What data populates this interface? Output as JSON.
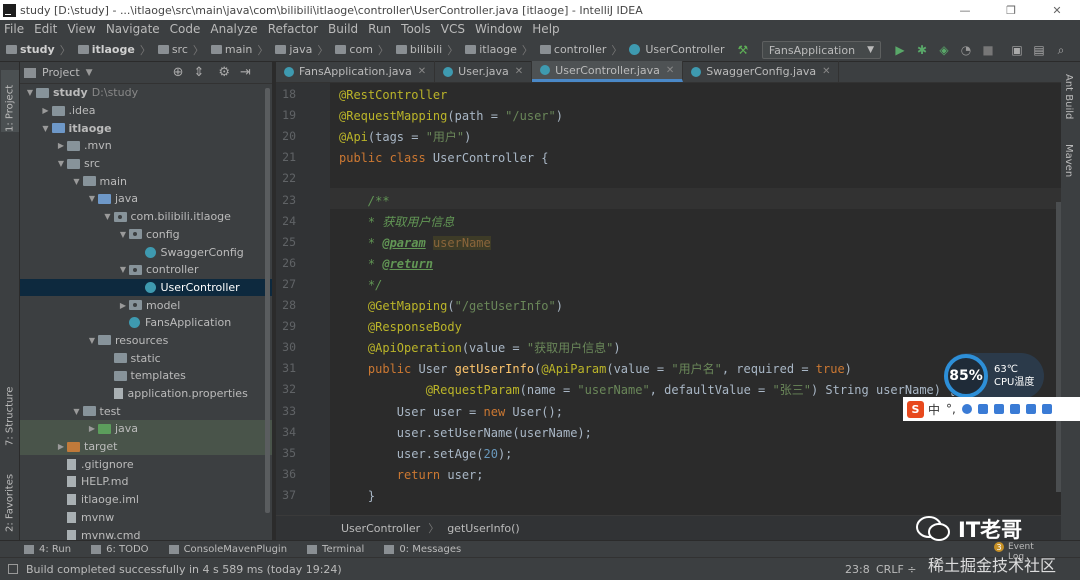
{
  "window": {
    "title": "study [D:\\study] - ...\\itlaoge\\src\\main\\java\\com\\bilibili\\itlaoge\\controller\\UserController.java [itlaoge] - IntelliJ IDEA",
    "min": "—",
    "max": "❐",
    "close": "✕"
  },
  "menu": [
    "File",
    "Edit",
    "View",
    "Navigate",
    "Code",
    "Analyze",
    "Refactor",
    "Build",
    "Run",
    "Tools",
    "VCS",
    "Window",
    "Help"
  ],
  "nav": {
    "crumbs": [
      "study",
      "itlaoge",
      "src",
      "main",
      "java",
      "com",
      "bilibili",
      "itlaoge",
      "controller",
      "UserController"
    ],
    "run_config": "FansApplication"
  },
  "left_tabs": {
    "project": "1: Project",
    "structure": "7: Structure",
    "favorites": "2: Favorites"
  },
  "project_panel": {
    "title": "Project",
    "items": [
      {
        "depth": 0,
        "arrow": "▼",
        "icon": "folder",
        "label": "study",
        "extra": "D:\\study",
        "bold": true
      },
      {
        "depth": 1,
        "arrow": "▶",
        "icon": "folder",
        "label": ".idea"
      },
      {
        "depth": 1,
        "arrow": "▼",
        "icon": "folder-blue",
        "label": "itlaoge",
        "bold": true
      },
      {
        "depth": 2,
        "arrow": "▶",
        "icon": "folder",
        "label": ".mvn"
      },
      {
        "depth": 2,
        "arrow": "▼",
        "icon": "folder",
        "label": "src"
      },
      {
        "depth": 3,
        "arrow": "▼",
        "icon": "folder",
        "label": "main"
      },
      {
        "depth": 4,
        "arrow": "▼",
        "icon": "folder-blue",
        "label": "java"
      },
      {
        "depth": 5,
        "arrow": "▼",
        "icon": "package",
        "label": "com.bilibili.itlaoge"
      },
      {
        "depth": 6,
        "arrow": "▼",
        "icon": "package",
        "label": "config"
      },
      {
        "depth": 7,
        "arrow": "",
        "icon": "class",
        "label": "SwaggerConfig"
      },
      {
        "depth": 6,
        "arrow": "▼",
        "icon": "package",
        "label": "controller"
      },
      {
        "depth": 7,
        "arrow": "",
        "icon": "class",
        "label": "UserController",
        "selected": true
      },
      {
        "depth": 6,
        "arrow": "▶",
        "icon": "package",
        "label": "model"
      },
      {
        "depth": 6,
        "arrow": "",
        "icon": "class",
        "label": "FansApplication"
      },
      {
        "depth": 4,
        "arrow": "▼",
        "icon": "folder",
        "label": "resources"
      },
      {
        "depth": 5,
        "arrow": "",
        "icon": "folder",
        "label": "static"
      },
      {
        "depth": 5,
        "arrow": "",
        "icon": "folder",
        "label": "templates"
      },
      {
        "depth": 5,
        "arrow": "",
        "icon": "file",
        "label": "application.properties"
      },
      {
        "depth": 3,
        "arrow": "▼",
        "icon": "folder",
        "label": "test"
      },
      {
        "depth": 4,
        "arrow": "▶",
        "icon": "folder-green",
        "label": "java",
        "test": true
      },
      {
        "depth": 2,
        "arrow": "▶",
        "icon": "folder-orange",
        "label": "target",
        "test": true
      },
      {
        "depth": 2,
        "arrow": "",
        "icon": "file",
        "label": ".gitignore"
      },
      {
        "depth": 2,
        "arrow": "",
        "icon": "file",
        "label": "HELP.md"
      },
      {
        "depth": 2,
        "arrow": "",
        "icon": "file",
        "label": "itlaoge.iml"
      },
      {
        "depth": 2,
        "arrow": "",
        "icon": "file",
        "label": "mvnw"
      },
      {
        "depth": 2,
        "arrow": "",
        "icon": "file",
        "label": "mvnw.cmd"
      }
    ]
  },
  "editor_tabs": [
    {
      "label": "FansApplication.java",
      "active": false
    },
    {
      "label": "User.java",
      "active": false
    },
    {
      "label": "UserController.java",
      "active": true
    },
    {
      "label": "SwaggerConfig.java",
      "active": false
    }
  ],
  "line_numbers": [
    "18",
    "19",
    "20",
    "21",
    "22",
    "23",
    "24",
    "25",
    "26",
    "27",
    "28",
    "29",
    "30",
    "31",
    "32",
    "33",
    "34",
    "35",
    "36",
    "37"
  ],
  "code_lines": [
    [
      [
        "ann",
        "@RestController"
      ]
    ],
    [
      [
        "ann",
        "@RequestMapping"
      ],
      [
        "cls",
        "(path = "
      ],
      [
        "str",
        "\"/user\""
      ],
      [
        "cls",
        ")"
      ]
    ],
    [
      [
        "ann",
        "@Api"
      ],
      [
        "cls",
        "(tags = "
      ],
      [
        "str",
        "\"用户\""
      ],
      [
        "cls",
        ")"
      ]
    ],
    [
      [
        "kw",
        "public class "
      ],
      [
        "cls",
        "UserController {"
      ]
    ],
    [
      [
        "cls",
        ""
      ]
    ],
    [
      [
        "cmt",
        "    /**"
      ]
    ],
    [
      [
        "cmt",
        "    * 获取用户信息"
      ]
    ],
    [
      [
        "cmt",
        "    * "
      ],
      [
        "tag",
        "@param"
      ],
      [
        "cmt",
        " "
      ],
      [
        "prm",
        "userName"
      ]
    ],
    [
      [
        "cmt",
        "    * "
      ],
      [
        "tag",
        "@return"
      ]
    ],
    [
      [
        "cmt",
        "    */"
      ]
    ],
    [
      [
        "ann",
        "    @GetMapping"
      ],
      [
        "cls",
        "("
      ],
      [
        "str",
        "\"/getUserInfo\""
      ],
      [
        "cls",
        ")"
      ]
    ],
    [
      [
        "ann",
        "    @ResponseBody"
      ]
    ],
    [
      [
        "ann",
        "    @ApiOperation"
      ],
      [
        "cls",
        "(value = "
      ],
      [
        "str",
        "\"获取用户信息\""
      ],
      [
        "cls",
        ")"
      ]
    ],
    [
      [
        "kw",
        "    public "
      ],
      [
        "cls",
        "User "
      ],
      [
        "fn",
        "getUserInfo"
      ],
      [
        "cls",
        "("
      ],
      [
        "ann",
        "@ApiParam"
      ],
      [
        "cls",
        "(value = "
      ],
      [
        "str",
        "\"用户名\""
      ],
      [
        "cls",
        ", required = "
      ],
      [
        "kw",
        "true"
      ],
      [
        "cls",
        ")"
      ]
    ],
    [
      [
        "ann",
        "            @RequestParam"
      ],
      [
        "cls",
        "(name = "
      ],
      [
        "str",
        "\"userName\""
      ],
      [
        "cls",
        ", defaultValue = "
      ],
      [
        "str",
        "\"张三\""
      ],
      [
        "cls",
        ") String userName) {"
      ]
    ],
    [
      [
        "cls",
        "        User user = "
      ],
      [
        "kw",
        "new "
      ],
      [
        "cls",
        "User();"
      ]
    ],
    [
      [
        "cls",
        "        user.setUserName(userName);"
      ]
    ],
    [
      [
        "cls",
        "        user.setAge("
      ],
      [
        "num",
        "20"
      ],
      [
        "cls",
        ");"
      ]
    ],
    [
      [
        "kw",
        "        return "
      ],
      [
        "cls",
        "user;"
      ]
    ],
    [
      [
        "cls",
        "    }"
      ]
    ]
  ],
  "editor_breadcrumb": {
    "cls": "UserController",
    "method": "getUserInfo()"
  },
  "right_tabs": {
    "ant": "Ant Build",
    "maven": "Maven"
  },
  "bottom_tools": [
    "4: Run",
    "6: TODO",
    "ConsoleMavenPlugin",
    "Terminal",
    "0: Messages"
  ],
  "status": {
    "message": "Build completed successfully in 4 s 589 ms (today 19:24)",
    "position": "23:8",
    "line_sep": "CRLF ÷",
    "event_log": "Event Log",
    "event_count": "3"
  },
  "overlay": {
    "gauge_percent": "85%",
    "temp": "63℃",
    "cpu_label": "CPU温度",
    "ime_chars": [
      "中",
      "°,"
    ],
    "watermark": "IT老哥",
    "watermark2": "稀土掘金技术社区"
  }
}
